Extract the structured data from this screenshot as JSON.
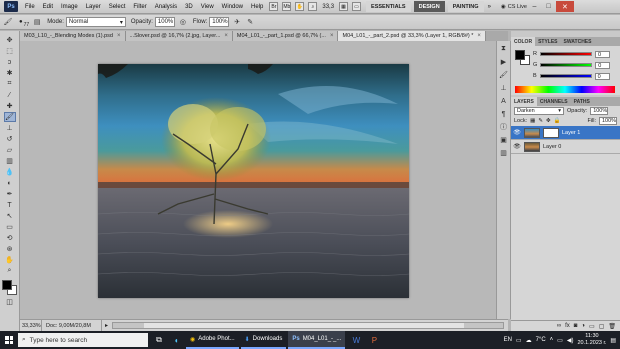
{
  "menubar": {
    "logo": "Ps",
    "items": [
      "File",
      "Edit",
      "Image",
      "Layer",
      "Select",
      "Filter",
      "Analysis",
      "3D",
      "View",
      "Window",
      "Help"
    ],
    "zoom": "33,3",
    "workspaces": [
      "ESSENTIALS",
      "DESIGN",
      "PAINTING"
    ],
    "active_workspace": "DESIGN",
    "more": "»",
    "cs_live": "CS Live",
    "win_controls": {
      "min": "–",
      "max": "□",
      "close": "✕"
    }
  },
  "options": {
    "brush_size": "77",
    "mode_label": "Mode:",
    "mode_value": "Normal",
    "opacity_label": "Opacity:",
    "opacity_value": "100%",
    "flow_label": "Flow:",
    "flow_value": "100%"
  },
  "tabs": [
    {
      "label": "M03_L10_-_Blending Modes (1).psd",
      "active": false
    },
    {
      "label": "...Slover.psd @ 16,7% (2.jpg, Layer...",
      "active": false
    },
    {
      "label": "M04_L01_-_part_1.psd @ 66,7% (...",
      "active": false
    },
    {
      "label": "M04_L01_-_part_2.psd @ 33,3% (Layer 1, RGB/8#) *",
      "active": true
    }
  ],
  "tab_close": "×",
  "status": {
    "zoom": "33,33%",
    "doc": "Doc: 9,00M/20,8M",
    "arrow": "▸"
  },
  "color_panel": {
    "tabs": [
      "COLOR",
      "STYLES",
      "SWATCHES"
    ],
    "sliders": [
      {
        "label": "R",
        "value": "0",
        "from": "#000000",
        "to": "#ff0000"
      },
      {
        "label": "G",
        "value": "0",
        "from": "#000000",
        "to": "#00ff00"
      },
      {
        "label": "B",
        "value": "0",
        "from": "#000000",
        "to": "#0000ff"
      }
    ]
  },
  "layers_panel": {
    "tabs": [
      "LAYERS",
      "CHANNELS",
      "PATHS"
    ],
    "blend_mode": "Darken",
    "opacity_label": "Opacity:",
    "opacity_value": "100%",
    "lock_label": "Lock:",
    "fill_label": "Fill:",
    "fill_value": "100%",
    "layers": [
      {
        "name": "Layer 1",
        "selected": true,
        "has_mask": true
      },
      {
        "name": "Layer 0",
        "selected": false,
        "has_mask": false
      }
    ]
  },
  "taskbar": {
    "search_placeholder": "Type here to search",
    "apps": [
      {
        "label": "Adobe Phot...",
        "active": false
      },
      {
        "label": "Downloads",
        "active": false
      },
      {
        "label": "M04_L01_-_...",
        "active": true
      }
    ],
    "lang": "EN",
    "weather": "7°C",
    "time": "11:30",
    "date": "20.1.2023 г."
  },
  "colors": {
    "accent": "#3975c6",
    "taskbar": "#1c1f26"
  }
}
